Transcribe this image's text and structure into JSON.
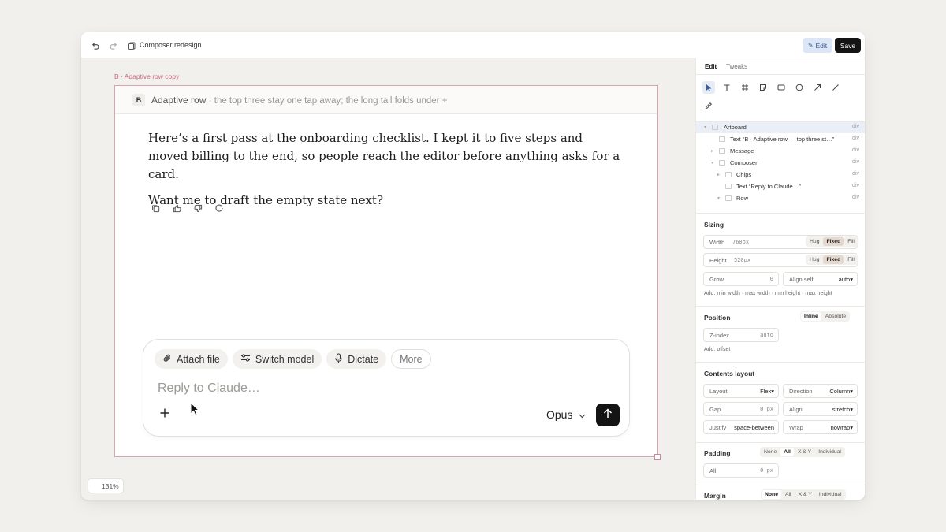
{
  "topbar": {
    "document_title": "Composer redesign",
    "edit_label": "Edit",
    "save_label": "Save"
  },
  "canvas": {
    "frame_label": "B · Adaptive row copy",
    "artboard": {
      "badge": "B",
      "title": "Adaptive row",
      "subtitle": "· the top three stay one tap away; the long tail folds under +"
    },
    "message": {
      "paragraphs": [
        "Here’s a first pass at the onboarding checklist. I kept it to five steps and moved billing to the end, so people reach the editor before anything asks for a card.",
        "Want me to draft the empty state next?"
      ],
      "actions": [
        "copy-icon",
        "thumbs-up-icon",
        "thumbs-down-icon",
        "retry-icon"
      ]
    },
    "composer": {
      "chips": [
        {
          "label": "Attach file",
          "icon": "paperclip-icon"
        },
        {
          "label": "Switch model",
          "icon": "sliders-icon"
        },
        {
          "label": "Dictate",
          "icon": "microphone-icon"
        }
      ],
      "more_label": "More",
      "placeholder": "Reply to Claude…",
      "model": "Opus"
    },
    "zoom": "131%"
  },
  "inspector": {
    "tabs": [
      "Edit",
      "Tweaks"
    ],
    "tools": [
      "pointer-icon",
      "text-icon",
      "frame-icon",
      "sticky-icon",
      "rectangle-icon",
      "ellipse-icon",
      "arrow-icon",
      "line-icon",
      "pencil-icon"
    ],
    "layers": [
      {
        "name": "Artboard",
        "tag": "div"
      },
      {
        "name": "Text  “B · Adaptive row — top three st…”",
        "tag": "div"
      },
      {
        "name": "Message",
        "tag": "div"
      },
      {
        "name": "Composer",
        "tag": "div"
      },
      {
        "name": "Chips",
        "tag": "div"
      },
      {
        "name": "Text  “Reply to Claude…”",
        "tag": "div"
      },
      {
        "name": "Row",
        "tag": "div"
      }
    ],
    "sizing": {
      "title": "Sizing",
      "width_label": "Width",
      "width_value": "760px",
      "height_label": "Height",
      "height_value": "520px",
      "modes": [
        "Hug",
        "Fixed",
        "Fill"
      ],
      "grow_label": "Grow",
      "grow_value": "0",
      "align_self_label": "Align self",
      "align_self_value": "auto",
      "add_hint": "Add: min width · max width · min height · max height"
    },
    "position": {
      "title": "Position",
      "modes": [
        "Inline",
        "Absolute"
      ],
      "zindex_label": "Z-index",
      "zindex_value": "auto",
      "add_hint": "Add: offset"
    },
    "contents": {
      "title": "Contents layout",
      "layout_label": "Layout",
      "layout_value": "Flex",
      "direction_label": "Direction",
      "direction_value": "Column",
      "gap_label": "Gap",
      "gap_value": "0 px",
      "align_label": "Align",
      "align_value": "stretch",
      "justify_label": "Justify",
      "justify_value": "space-between",
      "wrap_label": "Wrap",
      "wrap_value": "nowrap"
    },
    "padding": {
      "title": "Padding",
      "modes": [
        "None",
        "All",
        "X & Y",
        "Individual"
      ],
      "all_label": "All",
      "all_value": "0 px"
    },
    "margin": {
      "title": "Margin",
      "modes": [
        "None",
        "All",
        "X & Y",
        "Individual"
      ]
    }
  }
}
